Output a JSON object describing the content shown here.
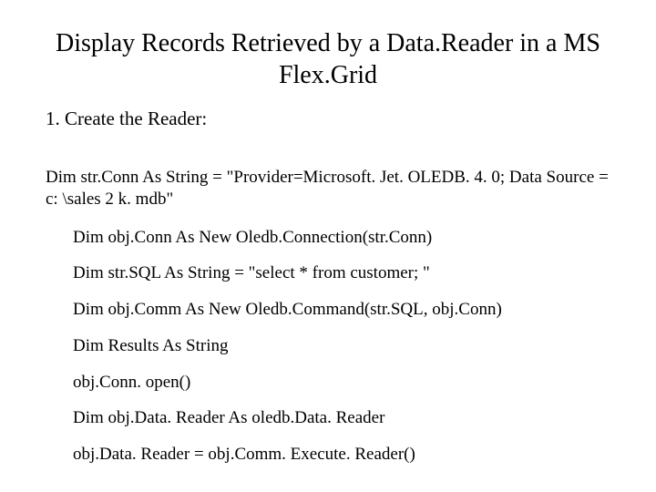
{
  "title": "Display Records Retrieved by a Data.Reader in a MS Flex.Grid",
  "step": "1. Create the Reader:",
  "conn_str": "Dim str.Conn As String = \"Provider=Microsoft. Jet. OLEDB. 4. 0; Data Source = c: \\sales 2 k. mdb\"",
  "lines": {
    "l1": "Dim obj.Conn As New Oledb.Connection(str.Conn)",
    "l2": "Dim str.SQL As String = \"select * from customer; \"",
    "l3": "Dim obj.Comm As New Oledb.Command(str.SQL, obj.Conn)",
    "l4": "Dim Results As String",
    "l5": "obj.Conn. open()",
    "l6": "Dim obj.Data. Reader As oledb.Data. Reader",
    "l7": "obj.Data. Reader = obj.Comm. Execute. Reader()"
  }
}
